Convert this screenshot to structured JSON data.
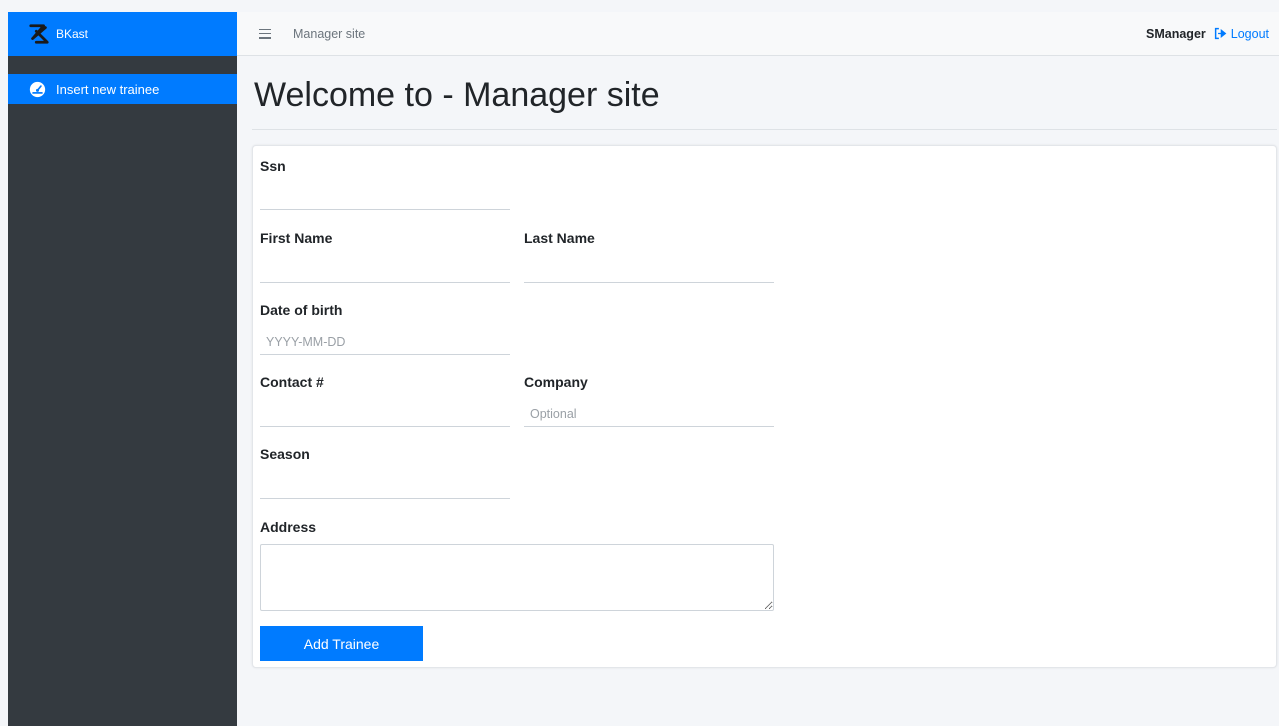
{
  "sidebar": {
    "brand": "BKast",
    "items": [
      {
        "label": "Insert new trainee",
        "icon": "tachometer-icon"
      }
    ]
  },
  "topbar": {
    "title": "Manager site",
    "username": "SManager",
    "logout_label": "Logout"
  },
  "page": {
    "title": "Welcome to - Manager site"
  },
  "form": {
    "ssn_label": "Ssn",
    "ssn_value": "",
    "first_name_label": "First Name",
    "first_name_value": "",
    "last_name_label": "Last Name",
    "last_name_value": "",
    "dob_label": "Date of birth",
    "dob_placeholder": "YYYY-MM-DD",
    "contact_label": "Contact #",
    "contact_value": "",
    "company_label": "Company",
    "company_placeholder": "Optional",
    "season_label": "Season",
    "season_value": "",
    "address_label": "Address",
    "address_value": "",
    "submit_label": "Add Trainee"
  },
  "colors": {
    "primary": "#007bff",
    "sidebar_bg": "#343a40",
    "page_bg": "#f4f6f9"
  }
}
